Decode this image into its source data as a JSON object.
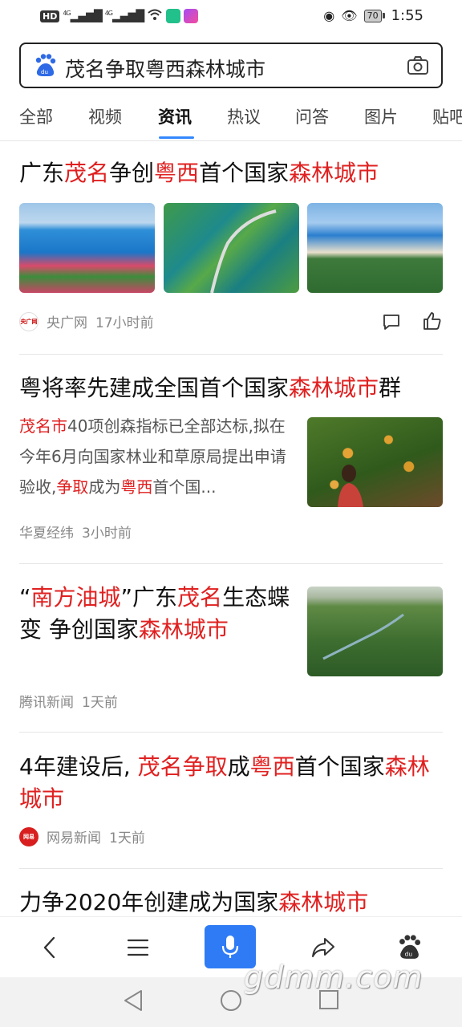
{
  "status_bar": {
    "network_chip": "HD",
    "signal_1_label": "4G",
    "signal_2_label": "4G",
    "battery": "70",
    "time": "1:55"
  },
  "search": {
    "query": "茂名争取粤西森林城市"
  },
  "tabs": [
    "全部",
    "视频",
    "资讯",
    "热议",
    "问答",
    "图片",
    "贴吧"
  ],
  "active_tab": "资讯",
  "articles": [
    {
      "title_parts": [
        "广东",
        "茂名",
        "争创",
        "粤西",
        "首个国家",
        "森林城市"
      ],
      "source": "央广网",
      "source_icon_text": "央广网",
      "time": "17小时前"
    },
    {
      "title_parts": [
        "粤将率先建成全国首个国家",
        "森林城市",
        "群"
      ],
      "snippet_parts": [
        "茂名市",
        "40项创森指标已全部达标,拟在今年6月向国家林业和草原局提出申请验收,",
        "争取",
        "成为",
        "粤西",
        "首个国..."
      ],
      "source": "华夏经纬",
      "time": "3小时前"
    },
    {
      "title_parts": [
        "“",
        "南方油城",
        "”广东",
        "茂名",
        "生态蝶变 争创国家",
        "森林城市"
      ],
      "source": "腾讯新闻",
      "time": "1天前"
    },
    {
      "title_parts": [
        "4年建设后, ",
        "茂名争取",
        "成",
        "粤西",
        "首个国家",
        "森林城市"
      ],
      "source": "网易新闻",
      "source_icon_text": "网易",
      "time": "1天前"
    },
    {
      "title_parts": [
        "力争2020年创建成为国家",
        "森林城市"
      ]
    }
  ],
  "watermark": "gdmm.com",
  "colors": {
    "highlight": "#e02020",
    "accent": "#3388ff",
    "mic_button": "#2f7bf6"
  },
  "icons": [
    "back-icon",
    "menu-icon",
    "mic-icon",
    "share-icon",
    "baidu-paw-icon",
    "comment-icon",
    "like-icon",
    "camera-icon"
  ]
}
